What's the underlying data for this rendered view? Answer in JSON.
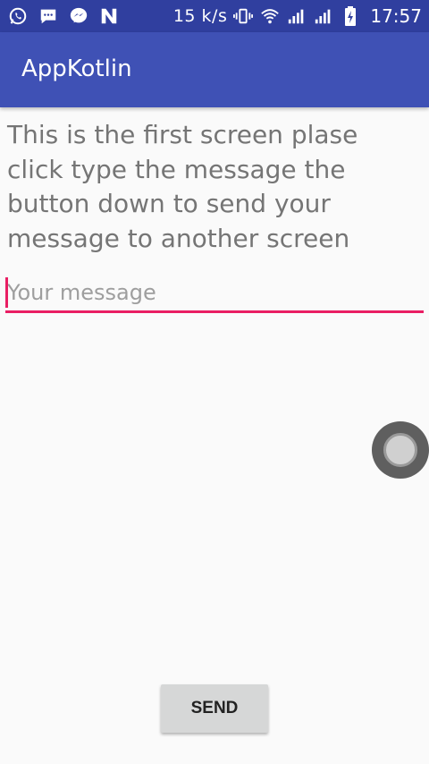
{
  "status_bar": {
    "icons_left": [
      "whatsapp-icon",
      "messages-icon",
      "messenger-icon",
      "n-icon"
    ],
    "net_speed": "15 k/s",
    "icons_right": [
      "vibrate-icon",
      "wifi-icon",
      "signal-icon",
      "signal-2-icon",
      "battery-charging-icon"
    ],
    "time": "17:57"
  },
  "app_bar": {
    "title": "AppKotlin"
  },
  "intro_text": "This is the first screen plase click type the message the button down to send your message to another screen",
  "message_input": {
    "placeholder": "Your message",
    "value": ""
  },
  "send_button": {
    "label": "SEND"
  },
  "colors": {
    "status_bar": "#303f9f",
    "app_bar": "#3f51b5",
    "accent": "#e91e63"
  }
}
